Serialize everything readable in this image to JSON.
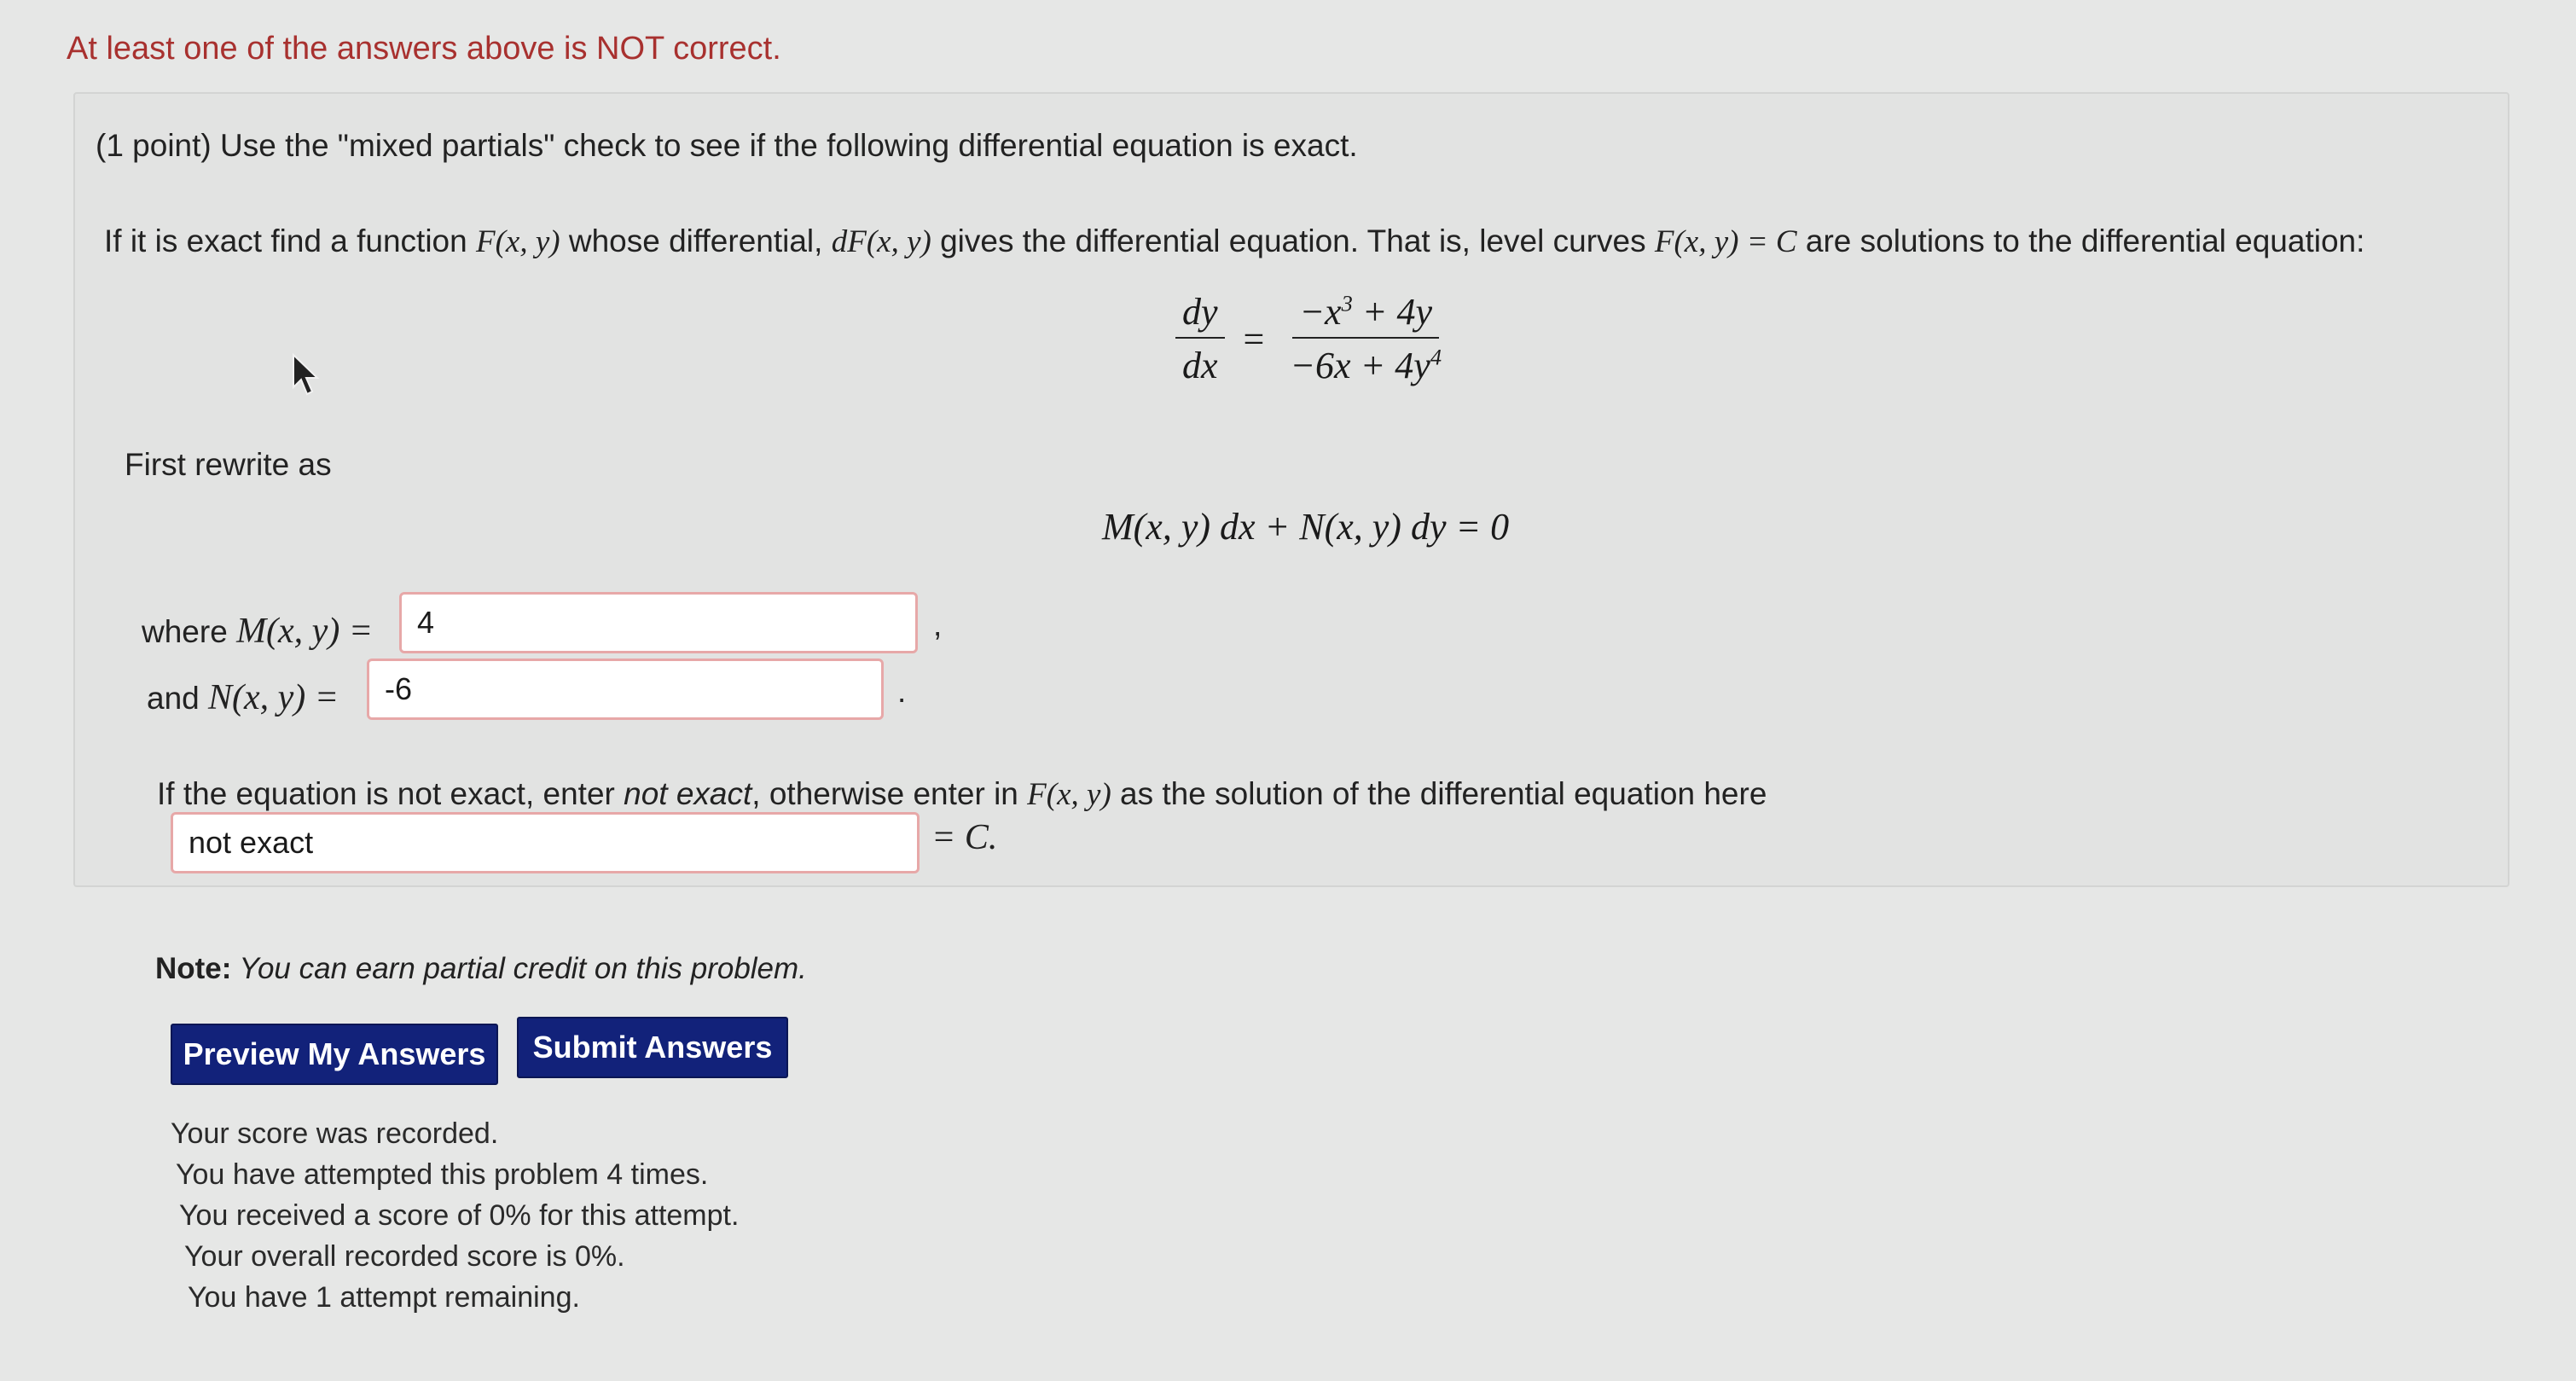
{
  "warning": "At least one of the answers above is NOT correct.",
  "problem": {
    "intro": "(1 point) Use the \"mixed partials\" check to see if the following differential equation is exact.",
    "instruction_pre": "If it is exact find a function ",
    "instruction_F": "F(x, y)",
    "instruction_mid1": " whose differential, ",
    "instruction_dF": "dF(x, y)",
    "instruction_mid2": " gives the differential equation. That is, level curves ",
    "instruction_level": "F(x, y) = C",
    "instruction_post": " are solutions to the differential equation:",
    "equation": {
      "lhs_num": "dy",
      "lhs_den": "dx",
      "equals": "=",
      "rhs_num_a": "−x",
      "rhs_num_exp": "3",
      "rhs_num_b": " + 4y",
      "rhs_den_a": "−6x + 4y",
      "rhs_den_exp": "4"
    },
    "first_rewrite": "First rewrite as",
    "rewrite_equation": "M(x, y) dx + N(x, y) dy = 0",
    "m_label_text": "where ",
    "m_label_math": "M(x, y) =",
    "m_value": "4",
    "m_trailing": ",",
    "n_label_text": "and ",
    "n_label_math": "N(x, y) =",
    "n_value": "-6",
    "n_trailing": ".",
    "exact_prompt_pre": "If the equation is not exact, enter ",
    "exact_prompt_em": "not exact",
    "exact_prompt_mid": ", otherwise enter in ",
    "exact_prompt_F": "F(x, y)",
    "exact_prompt_post": " as the solution of the differential equation here",
    "answer_value": "not exact",
    "answer_suffix": "= C."
  },
  "note": {
    "label": "Note:",
    "text": " You can earn partial credit on this problem."
  },
  "buttons": {
    "preview": "Preview My Answers",
    "submit": "Submit Answers"
  },
  "status": [
    "Your score was recorded.",
    "You have attempted this problem 4 times.",
    "You received a score of 0% for this attempt.",
    "Your overall recorded score is 0%.",
    "You have 1 attempt remaining."
  ],
  "colors": {
    "warning": "#a8312f",
    "button": "#12227a",
    "field_border": "#e7a8a8"
  },
  "icons": {
    "cursor": "mouse-pointer-icon"
  }
}
